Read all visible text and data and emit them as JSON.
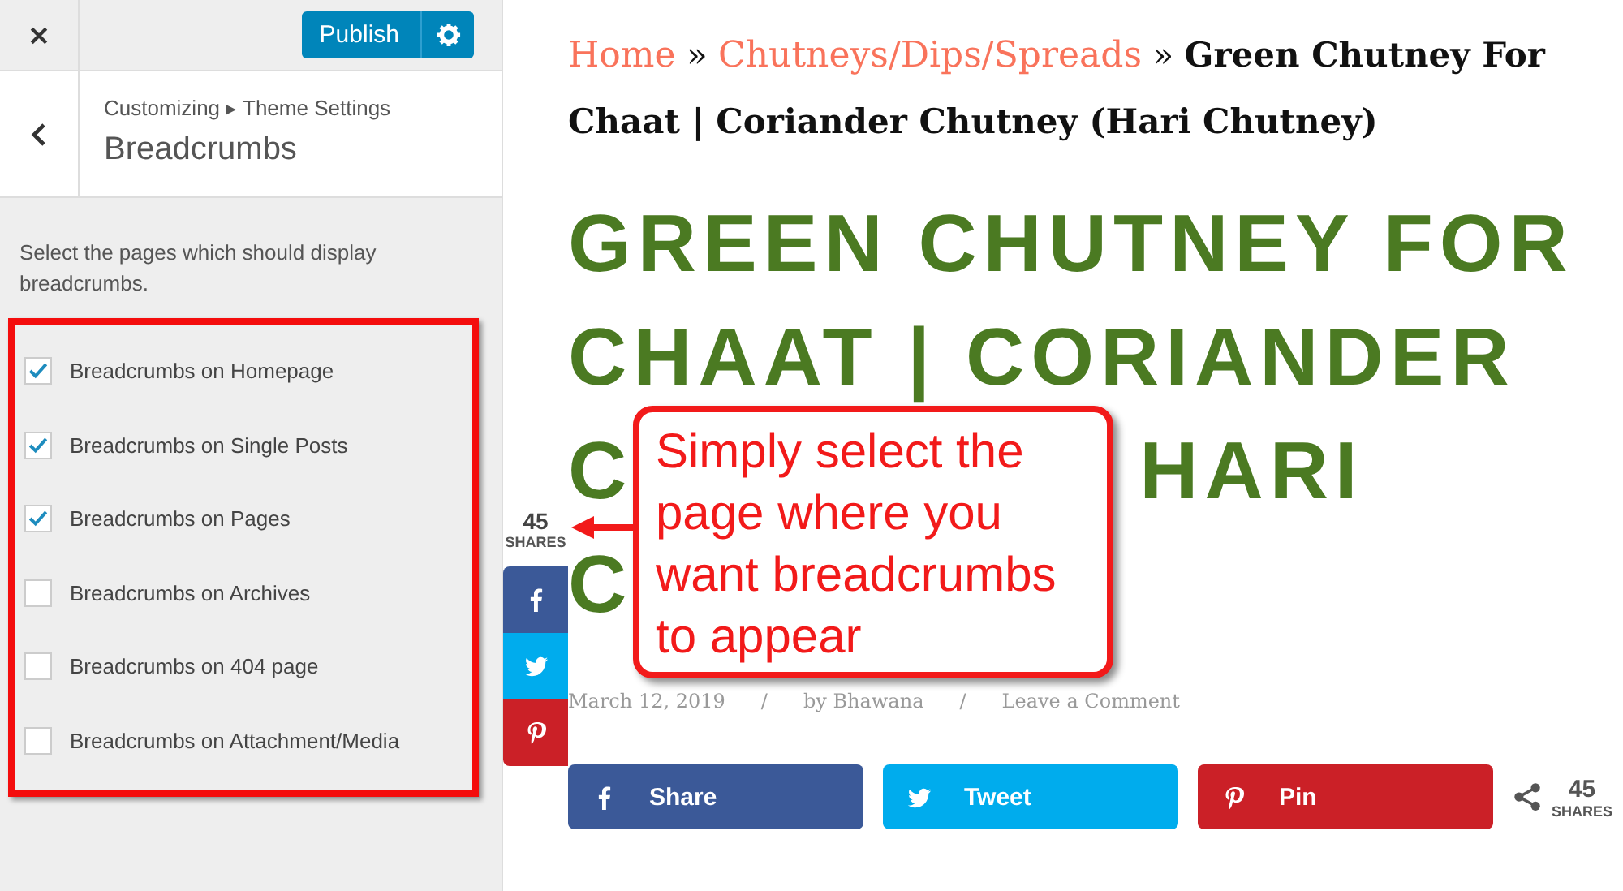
{
  "customizer": {
    "publish_label": "Publish",
    "context": "Customizing ▸ Theme Settings",
    "section_title": "Breadcrumbs",
    "description": "Select the pages which should display breadcrumbs.",
    "options": [
      {
        "label": "Breadcrumbs on Homepage",
        "checked": true
      },
      {
        "label": "Breadcrumbs on Single Posts",
        "checked": true
      },
      {
        "label": "Breadcrumbs on Pages",
        "checked": true
      },
      {
        "label": "Breadcrumbs on Archives",
        "checked": false
      },
      {
        "label": "Breadcrumbs on 404 page",
        "checked": false
      },
      {
        "label": "Breadcrumbs on Attachment/Media",
        "checked": false
      }
    ]
  },
  "preview": {
    "breadcrumbs": [
      {
        "kind": "link",
        "text": "Home"
      },
      {
        "kind": "separator",
        "text": "»"
      },
      {
        "kind": "link",
        "text": "Chutneys/Dips/Spreads"
      },
      {
        "kind": "separator",
        "text": "»"
      },
      {
        "kind": "current",
        "text": "Green Chutney For Chaat | Coriander Chutney (Hari Chutney)"
      }
    ],
    "title_lines": [
      [
        "GREEN CHUTNEY FOR"
      ],
      [
        "CHAAT | CORIANDER"
      ],
      [
        "C",
        "HARI"
      ],
      [
        "C"
      ]
    ],
    "meta": [
      "March 12, 2019",
      "/",
      "by Bhawana",
      "/",
      "Leave a Comment"
    ],
    "side_share": {
      "count": "45",
      "label": "SHARES",
      "buttons": [
        {
          "kind": "facebook"
        },
        {
          "kind": "twitter"
        },
        {
          "kind": "pinterest"
        }
      ]
    },
    "share_buttons": [
      {
        "kind": "facebook",
        "label": "Share"
      },
      {
        "kind": "twitter",
        "label": "Tweet"
      },
      {
        "kind": "pinterest",
        "label": "Pin"
      }
    ],
    "share_total": {
      "count": "45",
      "label": "SHARES"
    }
  },
  "callout": {
    "lines": [
      "Simply select the",
      "page where you",
      "want breadcrumbs",
      "to appear"
    ]
  }
}
